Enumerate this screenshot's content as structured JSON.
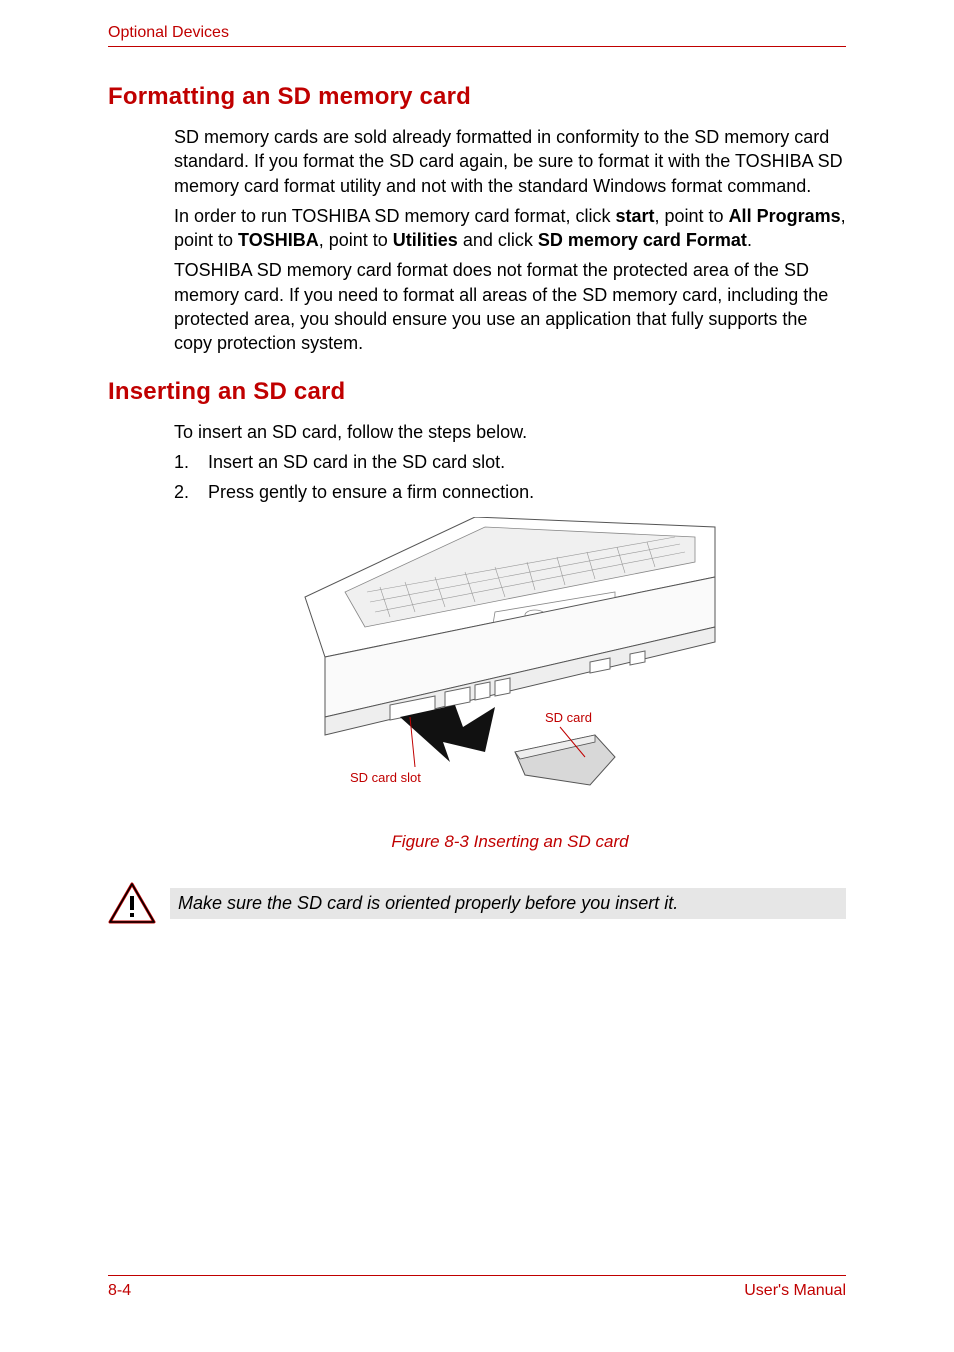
{
  "header": "Optional Devices",
  "section1": {
    "title": "Formatting an SD memory card",
    "para1": "SD memory cards are sold already formatted in conformity to the SD memory card standard. If you format the SD card again, be sure to format it with the TOSHIBA SD memory card format utility and not with the standard Windows format command.",
    "para2_pre": "In order to run TOSHIBA SD memory card format, click ",
    "para2_b1": "start",
    "para2_mid1": ", point to ",
    "para2_b2": "All Programs",
    "para2_mid2": ", point to ",
    "para2_b3": "TOSHIBA",
    "para2_mid3": ", point to ",
    "para2_b4": "Utilities",
    "para2_mid4": " and click ",
    "para2_b5": "SD memory card Format",
    "para2_end": ".",
    "para3": "TOSHIBA SD memory card format does not format the protected area of the SD memory card. If you need to format all areas of the SD memory card, including the protected area, you should ensure you use an application that fully supports the copy protection system."
  },
  "section2": {
    "title": "Inserting an SD card",
    "intro": "To insert an SD card, follow the steps below.",
    "steps": [
      {
        "num": "1.",
        "text": "Insert an SD card in the SD card slot."
      },
      {
        "num": "2.",
        "text": "Press gently to ensure a firm connection."
      }
    ]
  },
  "figure": {
    "label_card": "SD card",
    "label_slot": "SD card slot",
    "caption": "Figure 8-3 Inserting an SD card"
  },
  "caution": "Make sure the SD card is oriented properly before you insert it.",
  "footer": {
    "page": "8-4",
    "doc": "User's Manual"
  }
}
